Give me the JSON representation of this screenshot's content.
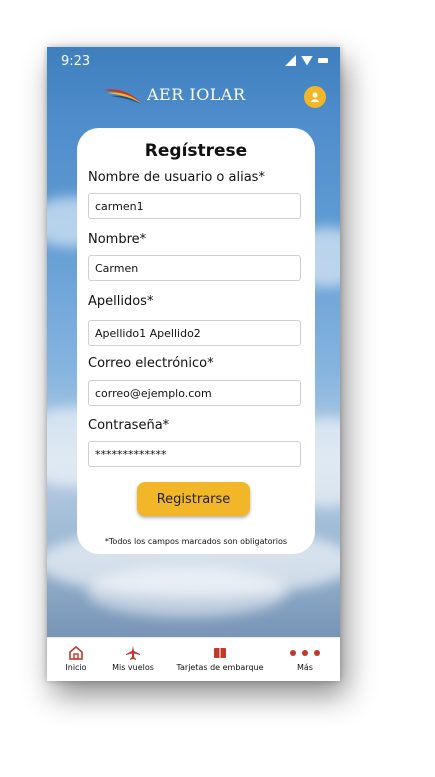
{
  "status": {
    "time": "9:23"
  },
  "header": {
    "brand": "AER IOLAR"
  },
  "form": {
    "title": "Regístrese",
    "fields": [
      {
        "label": "Nombre de usuario o alias*",
        "value": "carmen1"
      },
      {
        "label": "Nombre*",
        "value": "Carmen"
      },
      {
        "label": "Apellidos*",
        "value": "Apellido1 Apellido2"
      },
      {
        "label": "Correo electrónico*",
        "value": "correo@ejemplo.com"
      },
      {
        "label": "Contraseña*",
        "value": "*************"
      }
    ],
    "submit_label": "Registrarse",
    "note": "*Todos los campos marcados son obligatorios"
  },
  "nav": {
    "items": [
      {
        "label": "Inicio",
        "icon": "home-icon"
      },
      {
        "label": "Mis vuelos",
        "icon": "plane-icon"
      },
      {
        "label": "Tarjetas de embarque",
        "icon": "boarding-pass-icon"
      },
      {
        "label": "Más",
        "icon": "more-dots-icon"
      }
    ]
  },
  "colors": {
    "accent": "#f2b728",
    "nav_icon": "#c0392b",
    "sky": "#4e8ccb"
  }
}
